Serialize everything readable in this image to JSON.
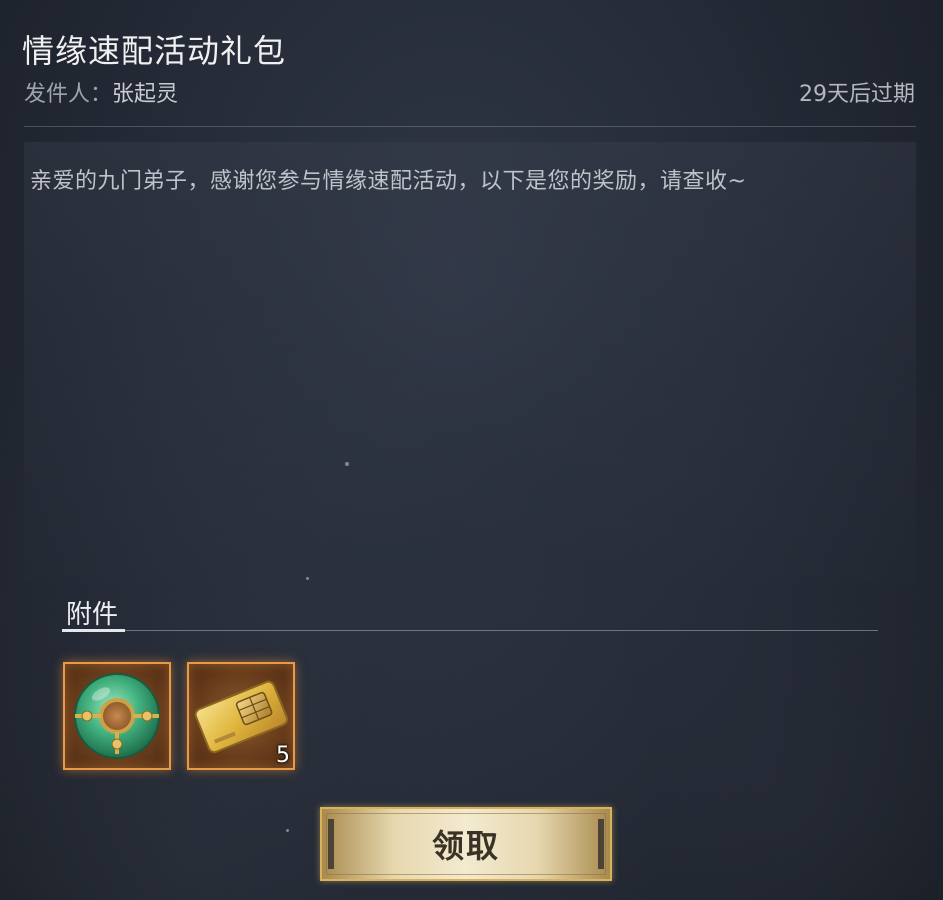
{
  "mail": {
    "title": "情缘速配活动礼包",
    "sender_label": "发件人：",
    "sender_name": "张起灵",
    "expiry": "29天后过期",
    "body": "亲爱的九门弟子，感谢您参与情缘速配活动，以下是您的奖励，请查收~"
  },
  "attachments": {
    "title": "附件",
    "items": [
      {
        "icon": "jade-ring-icon",
        "count": ""
      },
      {
        "icon": "gold-card-icon",
        "count": "5"
      }
    ]
  },
  "actions": {
    "claim_label": "领取"
  },
  "colors": {
    "item_border": "#e69a4a",
    "button_gold": "#d9b25a",
    "jade": "#4fbf8a"
  }
}
